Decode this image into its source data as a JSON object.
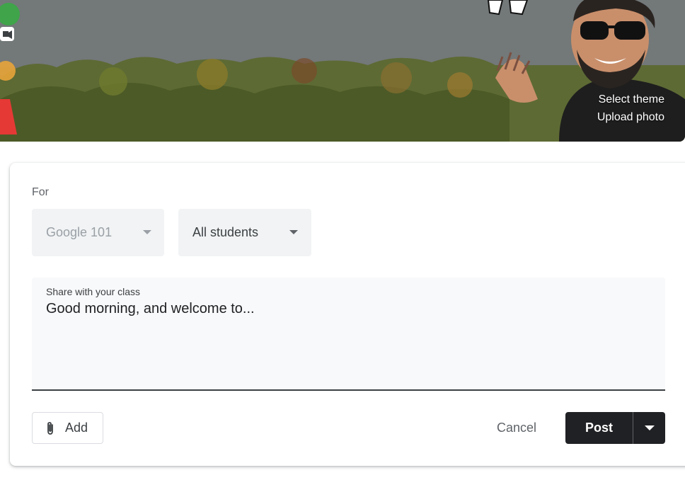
{
  "banner": {
    "select_theme_label": "Select theme",
    "upload_photo_label": "Upload photo"
  },
  "composer": {
    "for_label": "For",
    "class_select_value": "Google 101",
    "audience_select_value": "All students",
    "message_label": "Share with your class",
    "message_value": "Good morning, and welcome to..."
  },
  "actions": {
    "add_label": "Add",
    "cancel_label": "Cancel",
    "post_label": "Post"
  },
  "colors": {
    "primary_dark": "#202124",
    "field_bg": "#f1f3f4",
    "textarea_bg": "#f8f9fa"
  }
}
